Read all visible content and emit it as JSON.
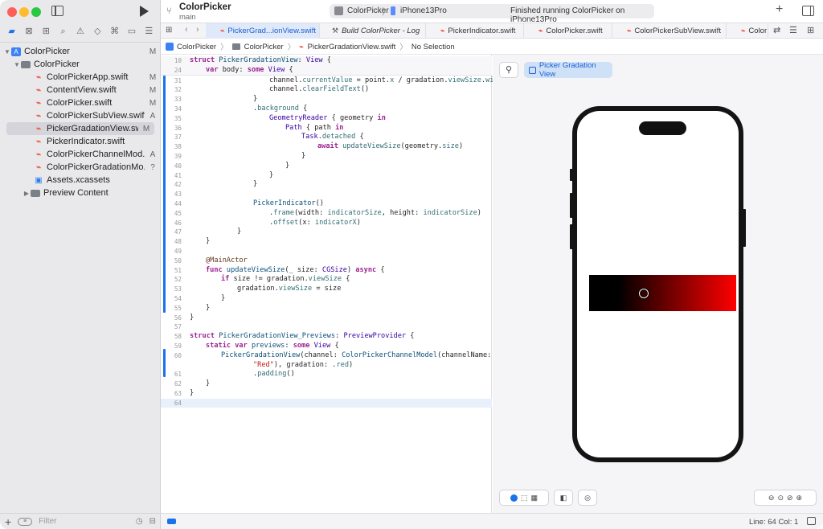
{
  "toolbar": {
    "project_title": "ColorPicker",
    "branch": "main",
    "scheme_app": "ColorPicker",
    "scheme_device": "iPhone13Pro",
    "status": "Finished running ColorPicker on iPhone13Pro"
  },
  "navigator": {
    "tree": [
      {
        "label": "ColorPicker",
        "status": "M",
        "kind": "proj"
      },
      {
        "label": "ColorPicker",
        "status": "",
        "kind": "folder"
      },
      {
        "label": "ColorPickerApp.swift",
        "status": "M",
        "kind": "swift"
      },
      {
        "label": "ContentView.swift",
        "status": "M",
        "kind": "swift"
      },
      {
        "label": "ColorPicker.swift",
        "status": "M",
        "kind": "swift"
      },
      {
        "label": "ColorPickerSubView.swift",
        "status": "A",
        "kind": "swift"
      },
      {
        "label": "PickerGradationView.swift",
        "status": "M",
        "kind": "swift"
      },
      {
        "label": "PickerIndicator.swift",
        "status": "",
        "kind": "swift"
      },
      {
        "label": "ColorPickerChannelMod...",
        "status": "A",
        "kind": "swift"
      },
      {
        "label": "ColorPickerGradationMo...",
        "status": "?",
        "kind": "swift"
      },
      {
        "label": "Assets.xcassets",
        "status": "",
        "kind": "assets"
      },
      {
        "label": "Preview Content",
        "status": "",
        "kind": "folder"
      }
    ],
    "filter_placeholder": "Filter"
  },
  "tabs": [
    {
      "label": "PickerGrad...ionView.swift",
      "kind": "swift"
    },
    {
      "label": "Build ColorPicker - Log",
      "kind": "log"
    },
    {
      "label": "PickerIndicator.swift",
      "kind": "swift"
    },
    {
      "label": "ColorPicker.swift",
      "kind": "swift"
    },
    {
      "label": "ColorPickerSubView.swift",
      "kind": "swift"
    },
    {
      "label": "Color",
      "kind": "swift"
    }
  ],
  "jumpbar": {
    "project": "ColorPicker",
    "folder": "ColorPicker",
    "file": "PickerGradationView.swift",
    "selection": "No Selection"
  },
  "code": {
    "line_numbers": [
      "10",
      "24",
      "31",
      "32",
      "33",
      "34",
      "35",
      "36",
      "37",
      "38",
      "39",
      "40",
      "41",
      "42",
      "43",
      "44",
      "45",
      "46",
      "47",
      "48",
      "49",
      "50",
      "51",
      "52",
      "53",
      "54",
      "55",
      "56",
      "57",
      "58",
      "59",
      "60",
      "",
      "61",
      "62",
      "63",
      "64"
    ]
  },
  "preview": {
    "chip_label": "Picker Gradation View",
    "indicator_position": 0.37
  },
  "statusbar": {
    "cursor": "Line: 64  Col: 1"
  },
  "colors": {
    "accent": "#1a73e8",
    "gradient_start": "#000000",
    "gradient_end": "#ff0000"
  }
}
